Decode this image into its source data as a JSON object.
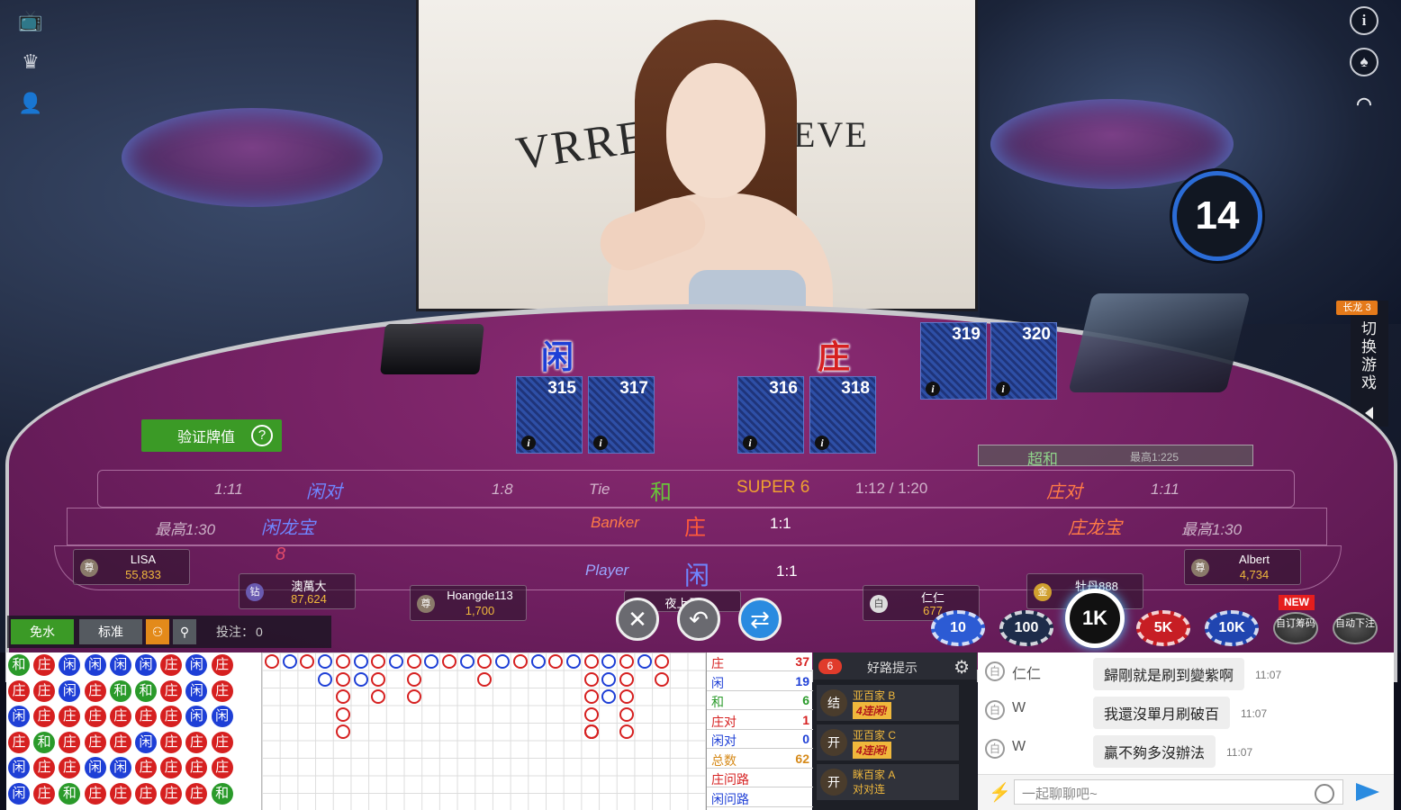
{
  "video": {
    "brand_left": "VRRE",
    "brand_right": "EVE"
  },
  "timer": {
    "seconds": "14"
  },
  "long_dragon": {
    "tag": "长龙 3",
    "label": "切换游戏"
  },
  "table": {
    "player_label": "闲",
    "banker_label": "庄",
    "player_cards": [
      "315",
      "317"
    ],
    "banker_cards": [
      "316",
      "318"
    ],
    "extra_cards": [
      "319",
      "320"
    ],
    "card_info_icon": "i",
    "verify_button": "验证牌值",
    "verify_help": "?",
    "zones": {
      "player_pair_odds": "1:11",
      "player_pair": "闲对",
      "tie_odds": "1:8",
      "tie_en": "Tie",
      "tie_cn": "和",
      "super6": "SUPER 6",
      "super6_odds": "1:12 / 1:20",
      "banker_pair": "庄对",
      "banker_pair_odds": "1:11",
      "player_dragon_max": "最高1:30",
      "player_dragon": "闲龙宝",
      "banker_en": "Banker",
      "banker_cn": "庄",
      "banker_odds": "1:1",
      "banker_dragon": "庄龙宝",
      "banker_dragon_max": "最高1:30",
      "player_en": "Player",
      "player_cn": "闲",
      "player_odds": "1:1",
      "super_tie": "超和",
      "super_tie_max": "最高1:225",
      "big_8": "8"
    },
    "seats": [
      {
        "badge": "尊",
        "name": "LISA",
        "amount": "55,833"
      },
      {
        "badge": "钻",
        "name": "澳萬大",
        "amount": "87,624"
      },
      {
        "badge": "尊",
        "name": "Hoangde113",
        "amount": "1,700"
      },
      {
        "badge": "",
        "name": "夜上子",
        "amount": ""
      },
      {
        "badge": "白",
        "name": "仁仁",
        "amount": "677"
      },
      {
        "badge": "金",
        "name": "牡丹888",
        "amount": ""
      },
      {
        "badge": "尊",
        "name": "Albert",
        "amount": "4,734"
      }
    ]
  },
  "chips": [
    "10",
    "100",
    "1K",
    "5K",
    "10K"
  ],
  "actions": {
    "custom_chips": "自订筹码",
    "auto_bet": "自动下注",
    "new_tag": "NEW"
  },
  "toolbar": {
    "free_commission": "免水",
    "standard": "标准",
    "bet_label": "投注：",
    "bet_value": "0"
  },
  "bead_road": [
    [
      "和",
      "庄",
      "闲",
      "闲",
      "闲",
      "闲",
      "庄",
      "闲",
      "庄"
    ],
    [
      "庄",
      "庄",
      "闲",
      "庄",
      "和",
      "和",
      "庄",
      "闲",
      "庄"
    ],
    [
      "闲",
      "庄",
      "庄",
      "庄",
      "庄",
      "庄",
      "庄",
      "闲",
      "闲"
    ],
    [
      "庄",
      "和",
      "庄",
      "庄",
      "庄",
      "闲",
      "庄",
      "庄",
      "庄"
    ],
    [
      "闲",
      "庄",
      "庄",
      "闲",
      "闲",
      "庄",
      "庄",
      "庄",
      "庄"
    ],
    [
      "闲",
      "庄",
      "和",
      "庄",
      "庄",
      "庄",
      "庄",
      "庄",
      "和"
    ]
  ],
  "stats": [
    {
      "label": "庄",
      "value": "37",
      "color": "#d62020"
    },
    {
      "label": "闲",
      "value": "19",
      "color": "#1e3fd6"
    },
    {
      "label": "和",
      "value": "6",
      "color": "#2a9a2a"
    },
    {
      "label": "庄对",
      "value": "1",
      "color": "#d62020"
    },
    {
      "label": "闲对",
      "value": "0",
      "color": "#1e3fd6"
    },
    {
      "label": "总数",
      "value": "62",
      "color": "#d68a1a"
    },
    {
      "label": "庄问路",
      "value": "",
      "color": "#d62020"
    },
    {
      "label": "闲问路",
      "value": "",
      "color": "#1e3fd6"
    }
  ],
  "good_road": {
    "count": "6",
    "title": "好路提示",
    "items": [
      {
        "status": "结",
        "table": "亚百家 B",
        "streak": "4连闲!",
        "plain": false
      },
      {
        "status": "开",
        "table": "亚百家 C",
        "streak": "4连闲!",
        "plain": false
      },
      {
        "status": "开",
        "table": "眯百家 A",
        "streak": "对对连",
        "plain": true
      }
    ]
  },
  "chat": {
    "messages": [
      {
        "avatar": "白",
        "user": "仁仁",
        "text": "歸剛就是刷到變紫啊",
        "time": "11:07"
      },
      {
        "avatar": "白",
        "user": "W",
        "text": "我還沒單月刷破百",
        "time": "11:07"
      },
      {
        "avatar": "白",
        "user": "W",
        "text": "贏不夠多沒辦法",
        "time": "11:07"
      }
    ],
    "placeholder": "一起聊聊吧~"
  },
  "colors": {
    "banker": "#d62020",
    "player": "#1e3fd6",
    "tie": "#2a9a2a",
    "accent_green": "#3b9a26"
  }
}
